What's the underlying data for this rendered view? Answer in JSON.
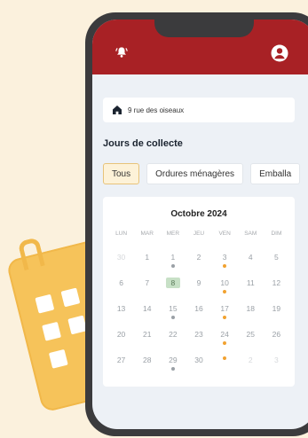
{
  "colors": {
    "background": "#fbf1dd",
    "topbar": "#a82125",
    "accent_orange": "#f1a230",
    "dot_grey": "#9aa0a6",
    "today_highlight": "#c7e0c6"
  },
  "header": {
    "bell_icon": "bell-icon",
    "user_icon": "user-icon"
  },
  "address": {
    "icon": "home-icon",
    "text": "9 rue des oiseaux"
  },
  "section_title": "Jours de collecte",
  "filters": [
    {
      "label": "Tous",
      "active": true
    },
    {
      "label": "Ordures ménagères",
      "active": false
    },
    {
      "label": "Emballa",
      "active": false
    }
  ],
  "calendar": {
    "month": "Octobre 2024",
    "weekdays": [
      "LUN",
      "MAR",
      "MER",
      "JEU",
      "VEN",
      "SAM",
      "DIM"
    ],
    "weeks": [
      [
        {
          "d": "30",
          "other": true
        },
        {
          "d": "1"
        },
        {
          "d": "1",
          "dot": "grey"
        },
        {
          "d": "2"
        },
        {
          "d": "3",
          "dot": "orange"
        },
        {
          "d": "4"
        },
        {
          "d": "5"
        }
      ],
      [
        {
          "d": "6"
        },
        {
          "d": "7"
        },
        {
          "d": "8",
          "today": true
        },
        {
          "d": "9"
        },
        {
          "d": "10",
          "dot": "orange"
        },
        {
          "d": "11"
        },
        {
          "d": "12"
        }
      ],
      [
        {
          "d": "13"
        },
        {
          "d": "14"
        },
        {
          "d": "15",
          "dot": "grey"
        },
        {
          "d": "16"
        },
        {
          "d": "17",
          "dot": "orange"
        },
        {
          "d": "18"
        },
        {
          "d": "19"
        }
      ],
      [
        {
          "d": "20"
        },
        {
          "d": "21"
        },
        {
          "d": "22"
        },
        {
          "d": "23"
        },
        {
          "d": "24",
          "dot": "orange"
        },
        {
          "d": "25"
        },
        {
          "d": "26"
        }
      ],
      [
        {
          "d": "27"
        },
        {
          "d": "28"
        },
        {
          "d": "29",
          "dot": "grey"
        },
        {
          "d": "30"
        },
        {
          "d": "",
          "dot": "orange"
        },
        {
          "d": "2",
          "other": true
        },
        {
          "d": "3",
          "other": true
        }
      ]
    ]
  }
}
